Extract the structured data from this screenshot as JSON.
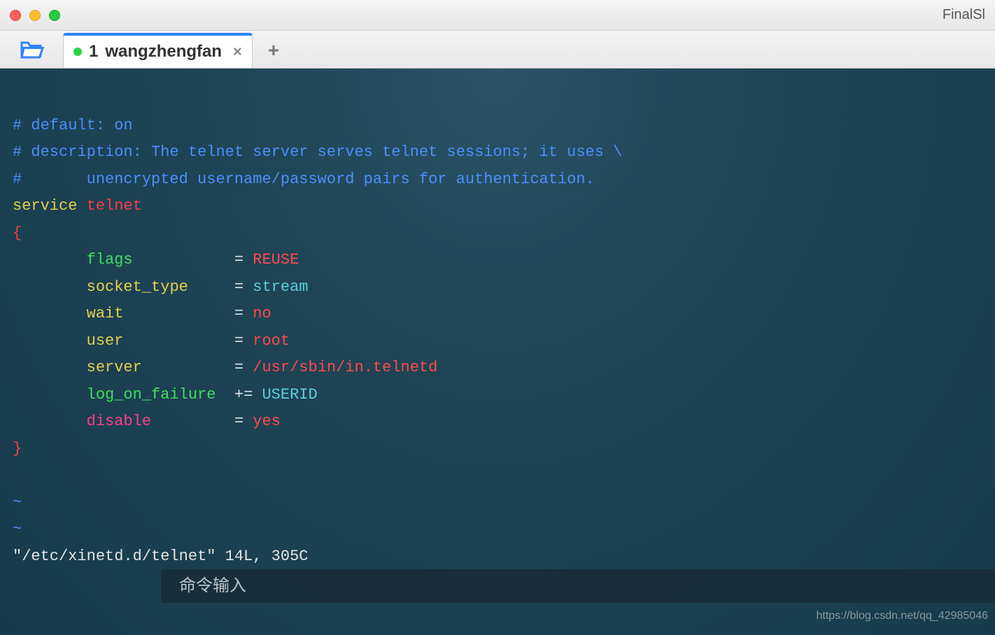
{
  "window": {
    "title": "FinalSl"
  },
  "tab": {
    "index": "1",
    "name": "wangzhengfan"
  },
  "file": {
    "comments": [
      "# default: on",
      "# description: The telnet server serves telnet sessions; it uses \\",
      "#       unencrypted username/password pairs for authentication."
    ],
    "service_kw": "service",
    "service_name": "telnet",
    "brace_open": "{",
    "brace_close": "}",
    "attrs": {
      "flags": {
        "key": "flags",
        "op": "=",
        "val": "REUSE"
      },
      "socket_type": {
        "key": "socket_type",
        "op": "=",
        "val": "stream"
      },
      "wait": {
        "key": "wait",
        "op": "=",
        "val": "no"
      },
      "user": {
        "key": "user",
        "op": "=",
        "val": "root"
      },
      "server": {
        "key": "server",
        "op": "=",
        "val": "/usr/sbin/in.telnetd"
      },
      "log_on_failure": {
        "key": "log_on_failure",
        "op": "+=",
        "val": "USERID"
      },
      "disable": {
        "key": "disable",
        "op": "=",
        "val": "yes"
      }
    },
    "tilde": "~",
    "status": "\"/etc/xinetd.d/telnet\" 14L, 305C"
  },
  "cmd": {
    "placeholder": "命令输入"
  },
  "watermark": "https://blog.csdn.net/qq_42985046"
}
